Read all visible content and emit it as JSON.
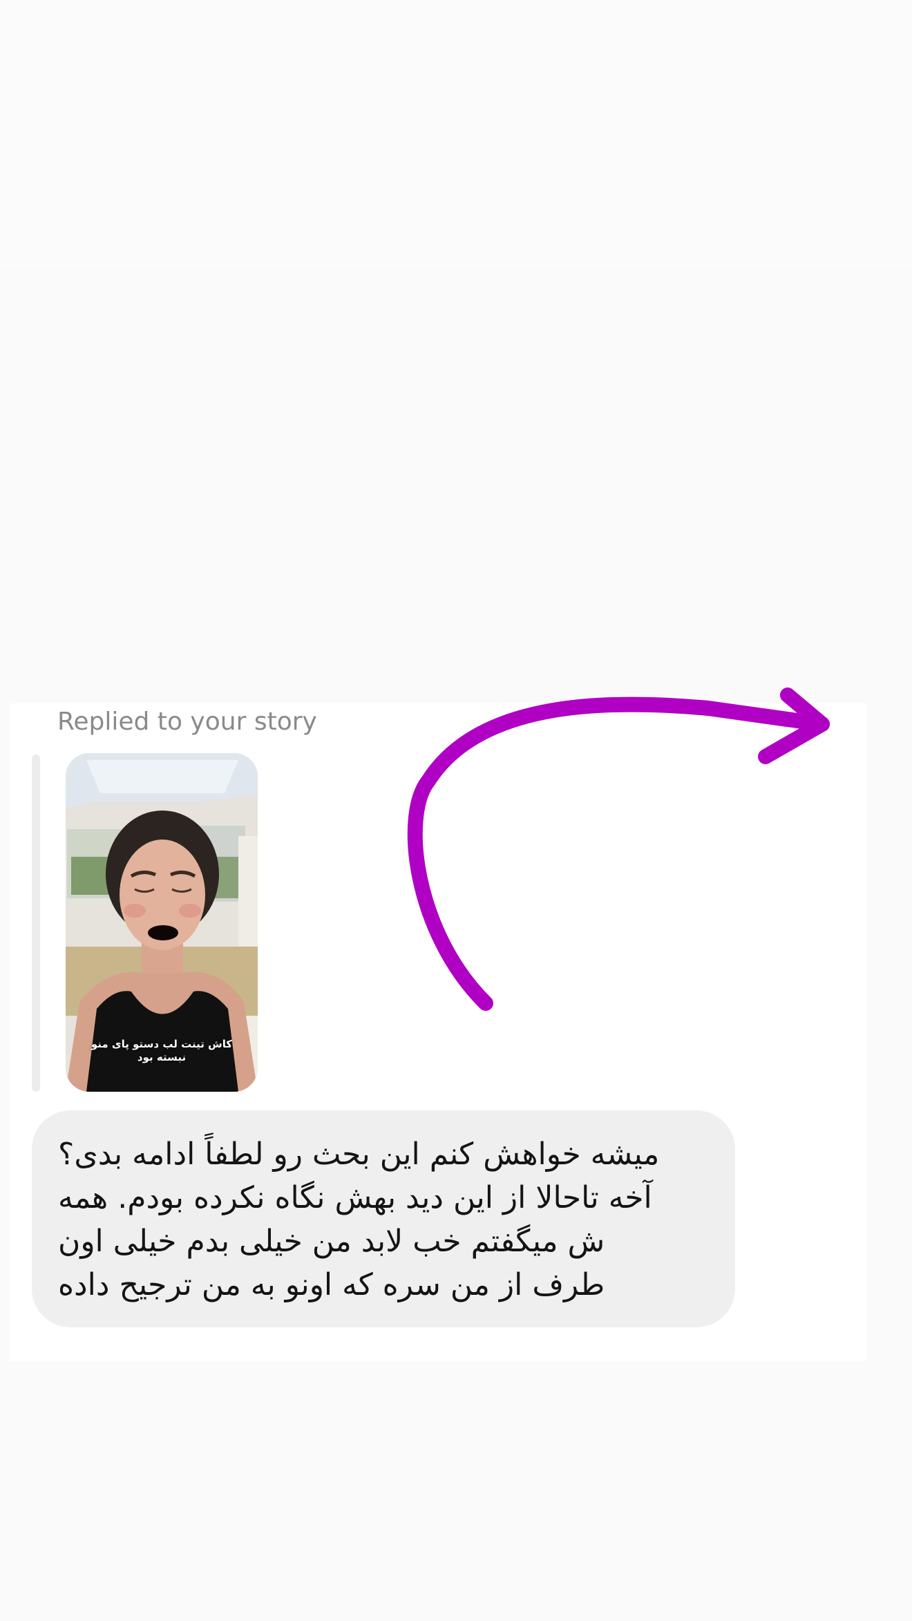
{
  "thread": {
    "reply_label": "Replied to your story",
    "story": {
      "caption": "کاش تینت لب دستو پای منو نبسته بود",
      "icon": "story-thumbnail-icon"
    },
    "message": {
      "text": "میشه خواهش کنم این بحث رو لطفاً ادامه بدی؟\nآخه تاحالا از این دید بهش نگاه نکرده بودم. همه\nش میگفتم خب لابد من خیلی بدم خیلی اون\nطرف از من سره که اونو به من ترجیح داده"
    }
  },
  "colors": {
    "background": "#fafafa",
    "bubble": "#efefef",
    "label": "#8a8a8a",
    "arrow": "#b000c4"
  },
  "annotation": {
    "icon": "curved-arrow-icon"
  }
}
